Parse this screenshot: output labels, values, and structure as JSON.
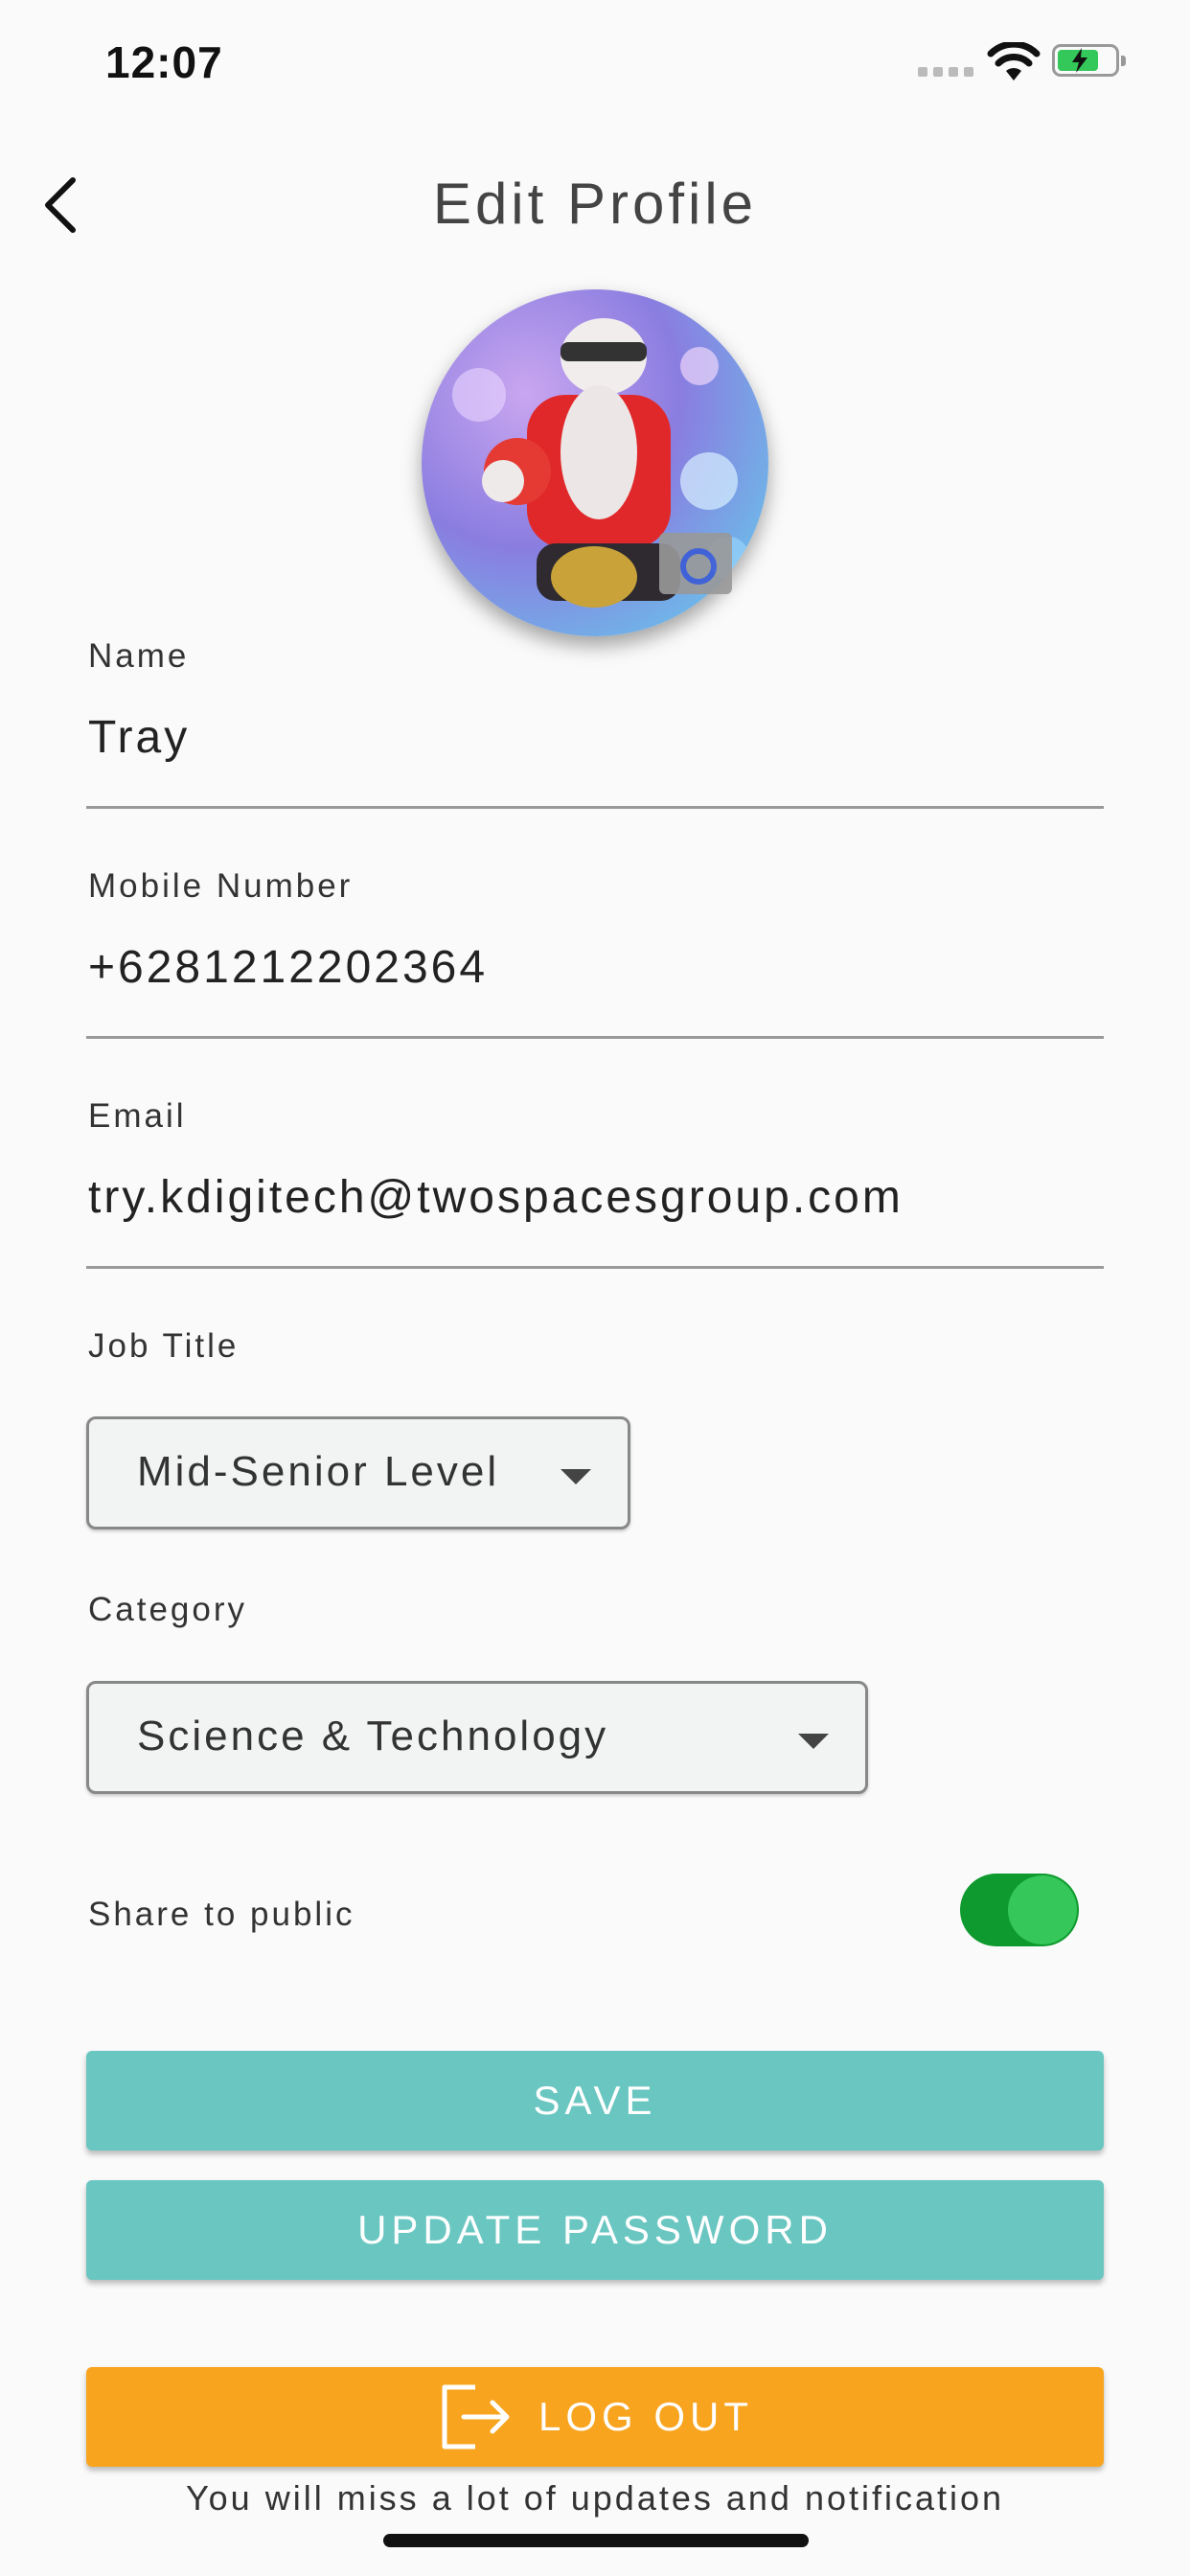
{
  "status": {
    "time": "12:07"
  },
  "header": {
    "title": "Edit Profile"
  },
  "fields": {
    "name": {
      "label": "Name",
      "value": "Tray"
    },
    "mobile": {
      "label": "Mobile Number",
      "value": "+6281212202364"
    },
    "email": {
      "label": "Email",
      "value": "try.kdigitech@twospacesgroup.com"
    }
  },
  "job_title": {
    "label": "Job Title",
    "selected": "Mid-Senior Level"
  },
  "category": {
    "label": "Category",
    "selected": "Science & Technology"
  },
  "share": {
    "label": "Share to public",
    "on": true
  },
  "buttons": {
    "save": "SAVE",
    "update_password": "UPDATE PASSWORD",
    "logout": "LOG OUT"
  },
  "logout_note": "You will miss a lot of updates and notification",
  "colors": {
    "accent_teal": "#6ac6c1",
    "logout_orange": "#f8a41e",
    "toggle_green": "#35c759"
  }
}
